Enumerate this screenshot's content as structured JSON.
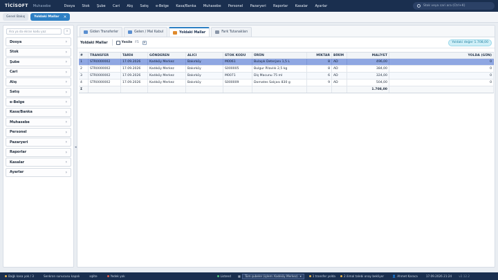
{
  "app": {
    "logo": "TİCİSOFT",
    "subtitle": "Muhasebe"
  },
  "menu": [
    "Dosya",
    "Stok",
    "Şube",
    "Cari",
    "Alış",
    "Satış",
    "e-Belge",
    "Kasa/Banka",
    "Muhasebe",
    "Personel",
    "Pazaryeri",
    "Raporlar",
    "Kasalar",
    "Ayarlar"
  ],
  "search": {
    "placeholder": "Stok veya cari ara (Ctrl+K)"
  },
  "page_tabs": [
    {
      "label": "Genel Bakış"
    },
    {
      "label": "Yoldaki Mallar",
      "close": "✕"
    }
  ],
  "sidebar": {
    "filter_placeholder": "Ara ya da ekran kodu yaz",
    "clear": "⨯",
    "items": [
      "Dosya",
      "Stok",
      "Şube",
      "Cari",
      "Alış",
      "Satış",
      "e-Belge",
      "Kasa/Banka",
      "Muhasebe",
      "Personel",
      "Pazaryeri",
      "Raporlar",
      "Kasalar",
      "Ayarlar"
    ]
  },
  "subtabs": [
    {
      "label": "Giden Transferler",
      "color": "#5a8fd0"
    },
    {
      "label": "Gelen / Mal Kabul",
      "color": "#5a8fd0"
    },
    {
      "label": "Yoldaki Mallar",
      "color": "#e08a2c"
    },
    {
      "label": "Fark Tutanakları",
      "color": "#8a96a8"
    }
  ],
  "toolbar": {
    "title": "Yoldaki Mallar",
    "refresh": "Yenile",
    "refresh_key": "F5",
    "pin": "P",
    "value_badge": "Yoldaki değer 1.708,00"
  },
  "table": {
    "columns": [
      "#",
      "TRANSFER",
      "TARİH",
      "GÖNDEREN",
      "ALICI",
      "STOK KODU",
      "ÜRÜN",
      "MİKTAR",
      "BİRİM",
      "MALİYET",
      "YOLDA (GÜN)"
    ],
    "rows": [
      [
        "1",
        "STR0000002",
        "17.09.2026",
        "Kadıköy Merkez",
        "Bakırköy",
        "M0061",
        "Bulaşık Deterjanı 1,5 L",
        "8",
        "AD",
        "496,00",
        "0"
      ],
      [
        "2",
        "STR0000002",
        "17.09.2026",
        "Kadıköy Merkez",
        "Bakırköy",
        "S000005",
        "Bulgur Pilavlık 2,5 kg",
        "8",
        "AD",
        "384,00",
        "0"
      ],
      [
        "3",
        "STR0000002",
        "17.09.2026",
        "Kadıköy Merkez",
        "Bakırköy",
        "M0071",
        "Diş Macunu 75 ml",
        "6",
        "AD",
        "324,00",
        "0"
      ],
      [
        "4",
        "STR0000002",
        "17.09.2026",
        "Kadıköy Merkez",
        "Bakırköy",
        "S000009",
        "Domates Salçası 830 g",
        "9",
        "AD",
        "504,00",
        "0"
      ]
    ],
    "total_label": "Σ",
    "total_value": "1.708,00"
  },
  "status": {
    "left": [
      "Bağlı kasa yok / 3",
      "Senkron sunucusu kapalı",
      "sqlite",
      "Yedek yok"
    ],
    "online": "Listend",
    "branch": "Tüm şubeler (işlem: Kadıköy Merkez)",
    "transfer": "1 transfer yolda",
    "approval": "2 ilimal talebi onay bekliyor",
    "user": "Ahmet Karaca",
    "datetime": "17.09.2026 21:24",
    "version": "v2.12.2"
  }
}
